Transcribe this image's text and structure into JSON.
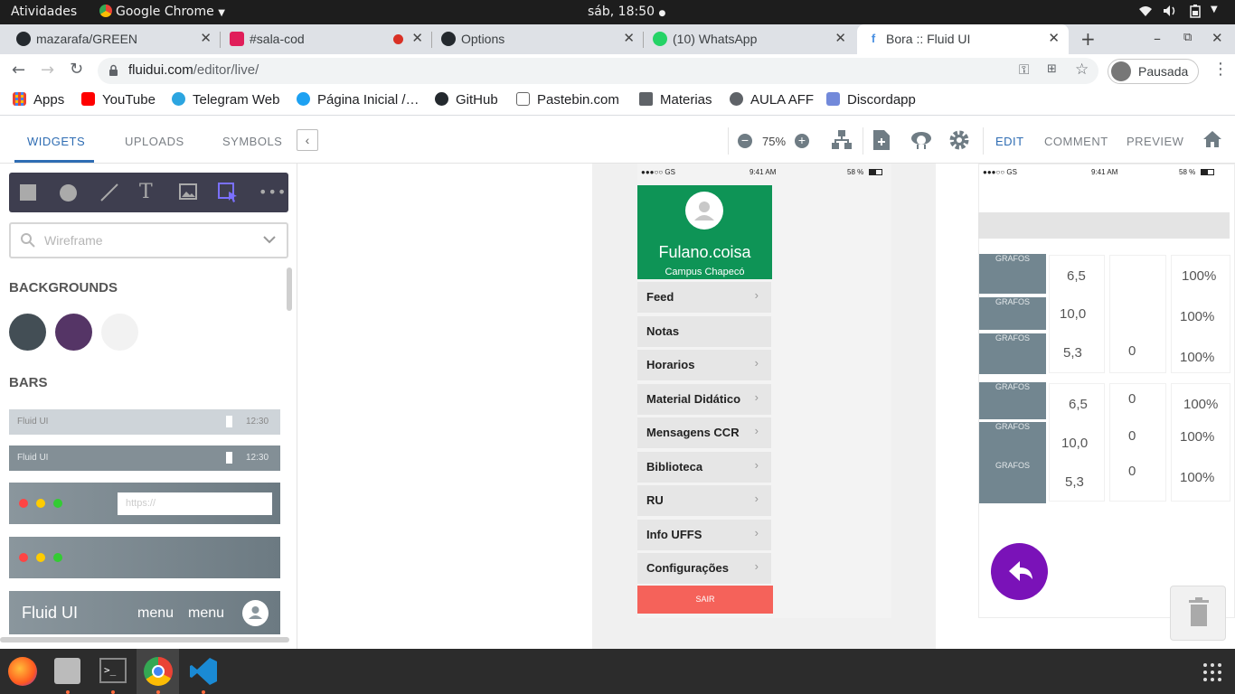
{
  "os": {
    "activities": "Atividades",
    "app_menu": "Google Chrome",
    "clock": "sáb, 18:50"
  },
  "chrome": {
    "tabs": [
      {
        "label": "mazarafa/GREEN",
        "icon": "github-icon"
      },
      {
        "label": "#sala-cod",
        "icon": "slack-icon"
      },
      {
        "label": "Options",
        "icon": "github-icon"
      },
      {
        "label": "(10) WhatsApp",
        "icon": "whatsapp-icon"
      },
      {
        "label": "Bora :: Fluid UI",
        "icon": "fluid-icon"
      }
    ],
    "url_host": "fluidui.com",
    "url_path": "/editor/live/",
    "profile_label": "Pausada",
    "bookmarks": [
      "Apps",
      "YouTube",
      "Telegram Web",
      "Página Inicial /…",
      "GitHub",
      "Pastebin.com",
      "Materias",
      "AULA AFF",
      "Discordapp"
    ]
  },
  "editor": {
    "tabs": [
      "WIDGETS",
      "UPLOADS",
      "SYMBOLS"
    ],
    "zoom": "75%",
    "mode_tabs": [
      "EDIT",
      "COMMENT",
      "PREVIEW"
    ],
    "search_placeholder": "Wireframe",
    "sections": {
      "backgrounds": "BACKGROUNDS",
      "bars": "BARS"
    },
    "bg_colors": [
      "#434e55",
      "#553566",
      "#f2f2f2"
    ],
    "bars": {
      "bar1_title": "Fluid UI",
      "bar1_time": "12:30",
      "bar2_title": "Fluid UI",
      "bar2_time": "12:30",
      "url_placeholder": "https://",
      "nav_title": "Fluid UI",
      "nav_menu1": "menu",
      "nav_menu2": "menu"
    }
  },
  "phone1": {
    "status_left": "●●●○○ GS",
    "status_time": "9:41 AM",
    "status_right": "58 %",
    "user_name": "Fulano.coisa",
    "user_campus": "Campus Chapecó",
    "menu": [
      "Feed",
      "Notas",
      "Horarios",
      "Material Didático",
      "Mensagens CCR",
      "Biblioteca",
      "RU",
      "Info UFFS",
      "Configurações"
    ],
    "logout": "SAIR"
  },
  "phone2": {
    "status_left": "●●●○○ GS",
    "status_time": "9:41 AM",
    "status_right": "58 %",
    "button_label": "GRAFOS",
    "table1": {
      "grades": [
        "6,5",
        "10,0",
        "5,3"
      ],
      "mid": [
        "",
        "",
        "0"
      ],
      "pct": [
        "100%",
        "100%",
        "100%"
      ]
    },
    "table2": {
      "grades": [
        "6,5",
        "10,0",
        "5,3"
      ],
      "mid": [
        "0",
        "0",
        "0"
      ],
      "pct": [
        "100%",
        "100%",
        "100%"
      ]
    }
  },
  "colors": {
    "fluid_green": "#0e9456",
    "logout_red": "#f5625a",
    "fab_purple": "#7a12b8"
  }
}
